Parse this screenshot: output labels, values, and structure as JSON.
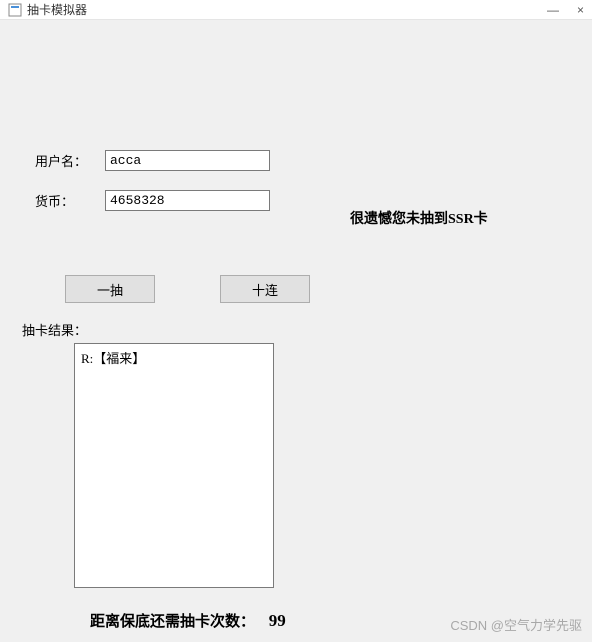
{
  "titlebar": {
    "title": "抽卡模拟器",
    "minimize": "—",
    "close": "×"
  },
  "form": {
    "username_label": "用户名：",
    "username_value": "acca",
    "currency_label": "货币：",
    "currency_value": "4658328"
  },
  "ssr_message": "很遗憾您未抽到SSR卡",
  "buttons": {
    "single_pull": "一抽",
    "ten_pull": "十连"
  },
  "result": {
    "label": "抽卡结果：",
    "lines": [
      "R:【福来】"
    ]
  },
  "pity": {
    "label": "距离保底还需抽卡次数：",
    "count": "99"
  },
  "watermark": "CSDN @空气力学先驱"
}
